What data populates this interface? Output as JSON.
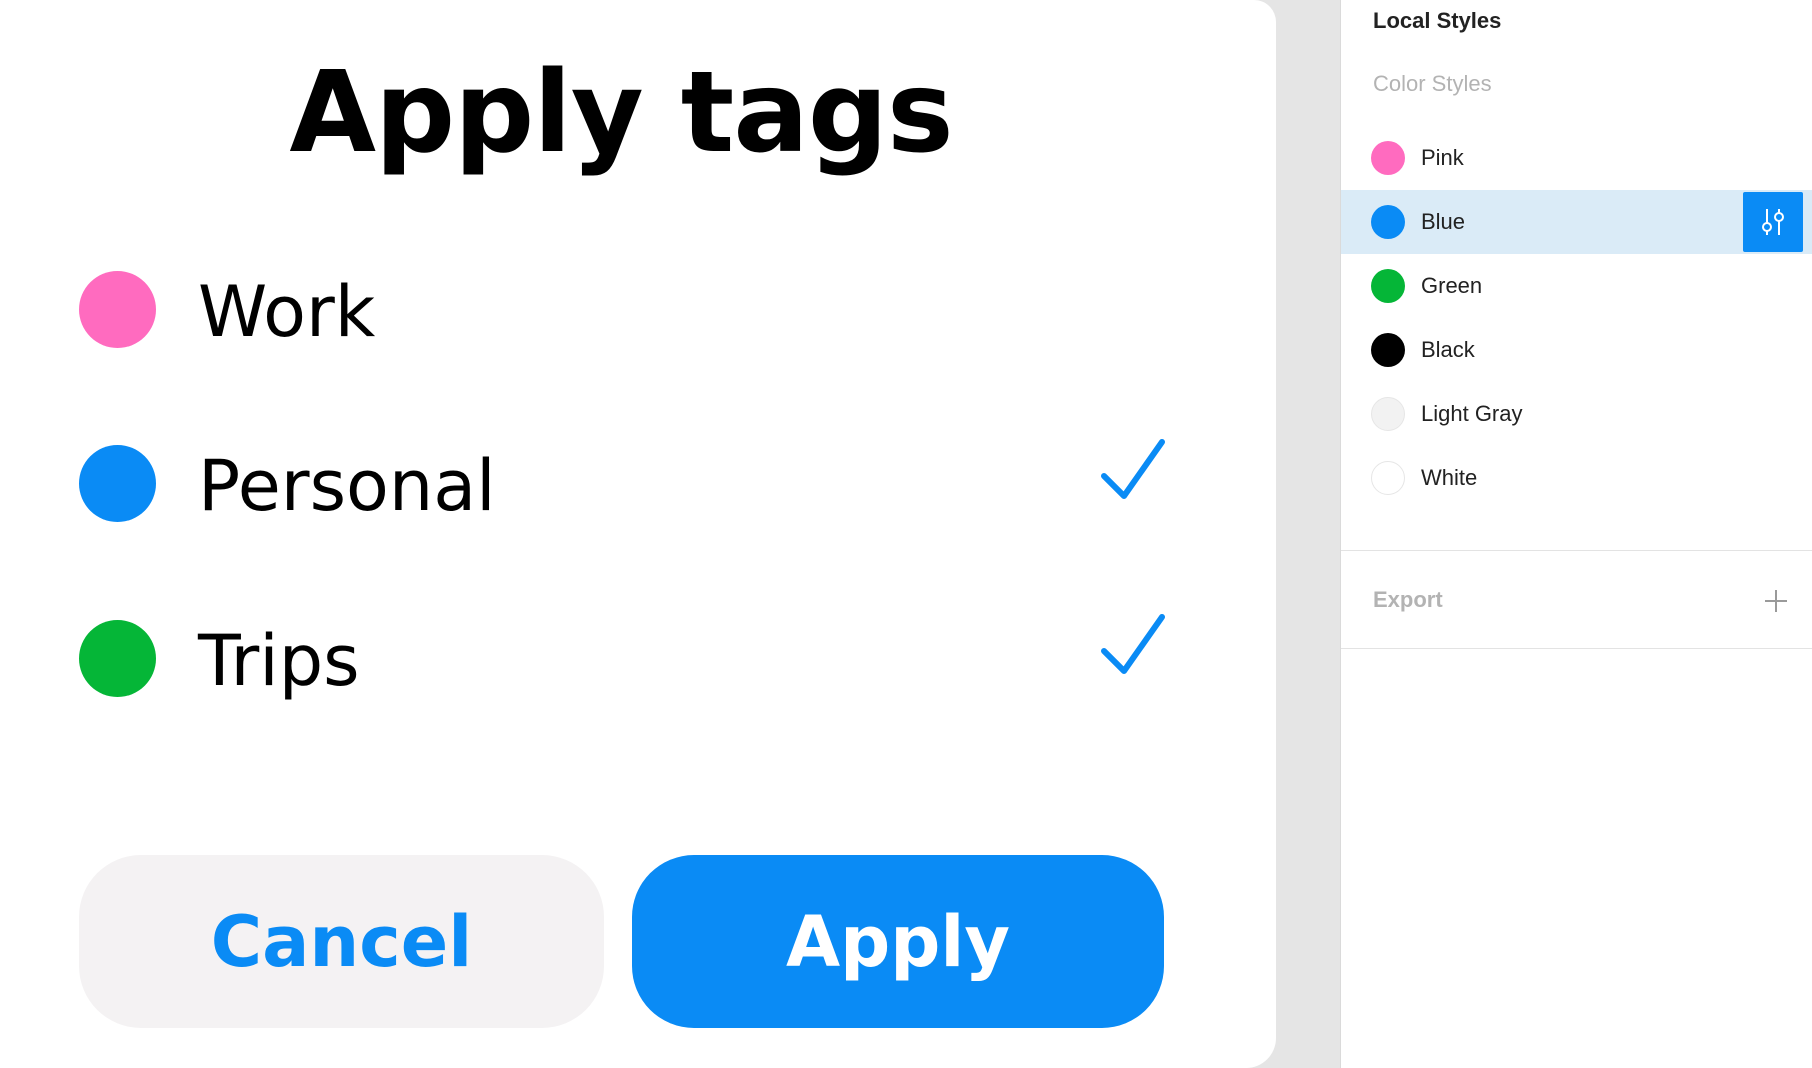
{
  "dialog": {
    "title": "Apply tags",
    "tags": [
      {
        "label": "Work",
        "color": "#ff6bbf",
        "checked": false
      },
      {
        "label": "Personal",
        "color": "#0a8bf5",
        "checked": true
      },
      {
        "label": "Trips",
        "color": "#05b637",
        "checked": true
      }
    ],
    "cancel_label": "Cancel",
    "apply_label": "Apply",
    "accent_color": "#0a8bf5",
    "check_icon": "checkmark-icon"
  },
  "panel": {
    "title": "Local Styles",
    "section_label": "Color Styles",
    "styles": [
      {
        "name": "Pink",
        "color": "#ff6bbf"
      },
      {
        "name": "Blue",
        "color": "#0a8bf5",
        "selected": true
      },
      {
        "name": "Green",
        "color": "#05b637"
      },
      {
        "name": "Black",
        "color": "#000000"
      },
      {
        "name": "Light Gray",
        "color": "#f2f2f2"
      },
      {
        "name": "White",
        "color": "#ffffff"
      }
    ],
    "edit_icon": "adjust-sliders-icon",
    "export_label": "Export",
    "export_icon": "plus-icon"
  }
}
